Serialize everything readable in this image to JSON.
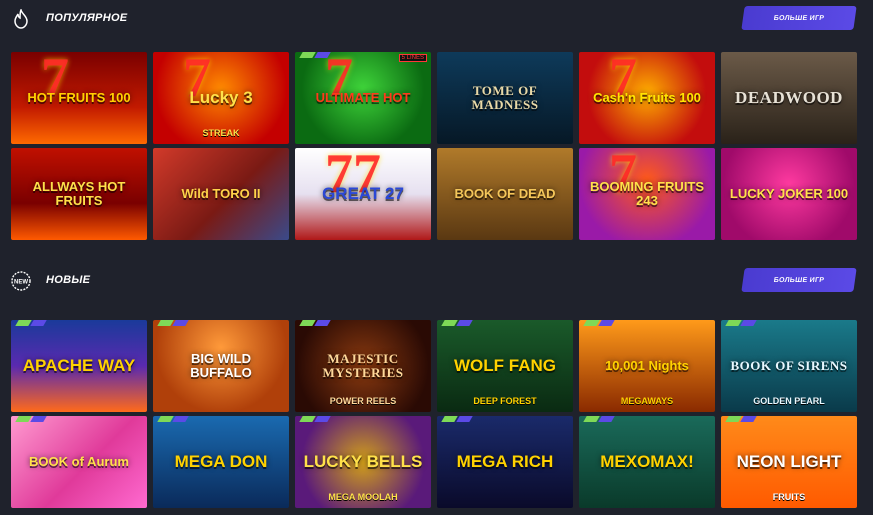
{
  "sections": [
    {
      "title": "ПОПУЛЯРНОЕ",
      "icon": "flame-icon",
      "more_label": "БОЛЬШЕ ИГР",
      "games": [
        {
          "title": "HOT FRUITS 100",
          "bg": "linear-gradient(180deg,#7a0000,#c21a00 60%,#ff6a00)",
          "color": "#ffd200",
          "deco": "7"
        },
        {
          "title": "Lucky 3",
          "sub": "STREAK",
          "bg": "radial-gradient(circle at 50% 40%,#ff8a00,#c40000 75%)",
          "color": "#ffe14a",
          "deco": "7"
        },
        {
          "title": "ULTIMATE HOT",
          "bg": "radial-gradient(circle at 50% 40%,#3fd43a,#0b6b12 70%)",
          "color": "#ff3a1a",
          "deco": "7",
          "lines": "5 LINES"
        },
        {
          "title": "TOME OF MADNESS",
          "bg": "linear-gradient(180deg,#0e3a5a,#061826)",
          "color": "#e8d9a8"
        },
        {
          "title": "Cash'n Fruits 100",
          "bg": "radial-gradient(circle at 50% 45%,#ffae00,#c30d0d 70%)",
          "color": "#ffe600",
          "deco": "7"
        },
        {
          "title": "DEADWOOD",
          "bg": "linear-gradient(180deg,#6b5a48,#2a2219)",
          "color": "#e8e2d6"
        },
        {
          "title": "ALLWAYS HOT FRUITS",
          "bg": "linear-gradient(180deg,#c01000,#7a0000 60%,#ff5a00)",
          "color": "#ffe14a"
        },
        {
          "title": "Wild TORO II",
          "bg": "linear-gradient(135deg,#d23a2a,#7a1a14 55%,#3a4a8a)",
          "color": "#ffd34a"
        },
        {
          "title": "GREAT 27",
          "bg": "linear-gradient(180deg,#ffffff,#e6e0f0 50%,#b01818)",
          "color": "#2b48d6",
          "deco": "77"
        },
        {
          "title": "BOOK OF DEAD",
          "bg": "linear-gradient(180deg,#b07a2a,#5a3812)",
          "color": "#f4c65a"
        },
        {
          "title": "BOOMING FRUITS 243",
          "bg": "radial-gradient(circle at 50% 35%,#ff5a1a,#9a1aa8 75%)",
          "color": "#ffe14a",
          "deco": "7"
        },
        {
          "title": "LUCKY JOKER 100",
          "bg": "radial-gradient(circle at 50% 40%,#ff3aa0,#a00a6a 75%)",
          "color": "#ffe14a"
        }
      ]
    },
    {
      "title": "НОВЫЕ",
      "icon": "new-badge-icon",
      "more_label": "БОЛЬШЕ ИГР",
      "games": [
        {
          "title": "APACHE WAY",
          "bg": "linear-gradient(180deg,#1a3a9a,#5a2ab0 50%,#ff6a1a)",
          "color": "#ffd200"
        },
        {
          "title": "BIG WILD BUFFALO",
          "bg": "radial-gradient(circle at 50% 30%,#ff9a3a,#b0400a 70%)",
          "color": "#ffffff"
        },
        {
          "title": "MAJESTIC MYSTERIES",
          "sub": "POWER REELS",
          "bg": "radial-gradient(circle at 50% 50%,#8a3a10,#2a0a04 80%)",
          "color": "#ffd89a"
        },
        {
          "title": "WOLF FANG",
          "sub": "DEEP FOREST",
          "bg": "linear-gradient(180deg,#1a5a2a,#0a2a12)",
          "color": "#ffd200"
        },
        {
          "title": "10,001 Nights",
          "sub": "MEGAWAYS",
          "bg": "linear-gradient(180deg,#ff9a1a,#8a2a00)",
          "color": "#ffd200"
        },
        {
          "title": "BOOK OF SIRENS",
          "sub": "GOLDEN PEARL",
          "bg": "linear-gradient(180deg,#1a7a8a,#0a3a4a)",
          "color": "#e8f8ff"
        },
        {
          "title": "BOOK of Aurum",
          "bg": "linear-gradient(135deg,#ff9ad0,#e03a9a 55%,#ff6ad0)",
          "color": "#ffe14a"
        },
        {
          "title": "MEGA DON",
          "bg": "linear-gradient(180deg,#1a6ab0,#0a2a5a)",
          "color": "#ffd200"
        },
        {
          "title": "LUCKY BELLS",
          "sub": "MEGA MOOLAH",
          "bg": "radial-gradient(circle at 50% 50%,#d2a01a,#5a1a7a 75%)",
          "color": "#ffe14a"
        },
        {
          "title": "MEGA RICH",
          "bg": "linear-gradient(180deg,#1a2a6a,#0a0a2a)",
          "color": "#ffd200"
        },
        {
          "title": "MEXOMAX!",
          "bg": "linear-gradient(180deg,#1a6a5a,#0a3a2a)",
          "color": "#ffd200"
        },
        {
          "title": "NEON LIGHT",
          "sub": "FRUITS",
          "bg": "linear-gradient(180deg,#ff8a1a,#ff5a00)",
          "color": "#ffffff"
        }
      ]
    }
  ]
}
